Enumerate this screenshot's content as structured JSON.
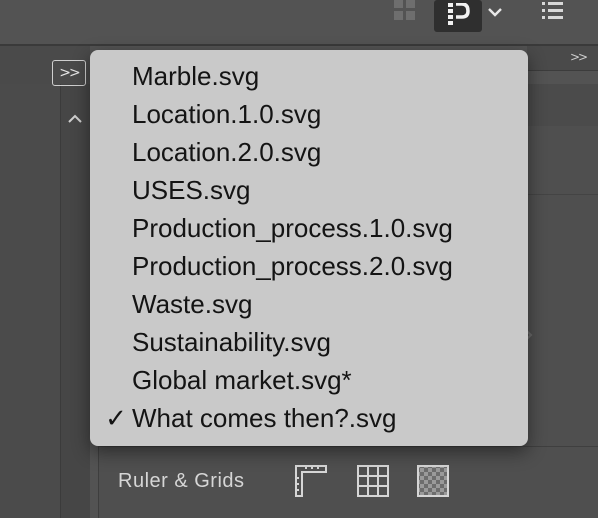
{
  "toolbar": {
    "icons": [
      "grid-view-icon",
      "properties-panel-icon",
      "chevron-down-icon",
      "list-view-icon"
    ]
  },
  "left_panel": {
    "expand_label": ">>"
  },
  "right_panel": {
    "collapse_label": ">>",
    "ruler_label": "Ruler & Grids"
  },
  "dropdown": {
    "items": [
      {
        "label": "Marble.svg",
        "checked": false
      },
      {
        "label": "Location.1.0.svg",
        "checked": false
      },
      {
        "label": "Location.2.0.svg",
        "checked": false
      },
      {
        "label": "USES.svg",
        "checked": false
      },
      {
        "label": "Production_process.1.0.svg",
        "checked": false
      },
      {
        "label": "Production_process.2.0.svg",
        "checked": false
      },
      {
        "label": "Waste.svg",
        "checked": false
      },
      {
        "label": "Sustainability.svg",
        "checked": false
      },
      {
        "label": "Global market.svg*",
        "checked": false
      },
      {
        "label": "What comes then?.svg",
        "checked": true
      }
    ],
    "check_mark": "✓"
  }
}
